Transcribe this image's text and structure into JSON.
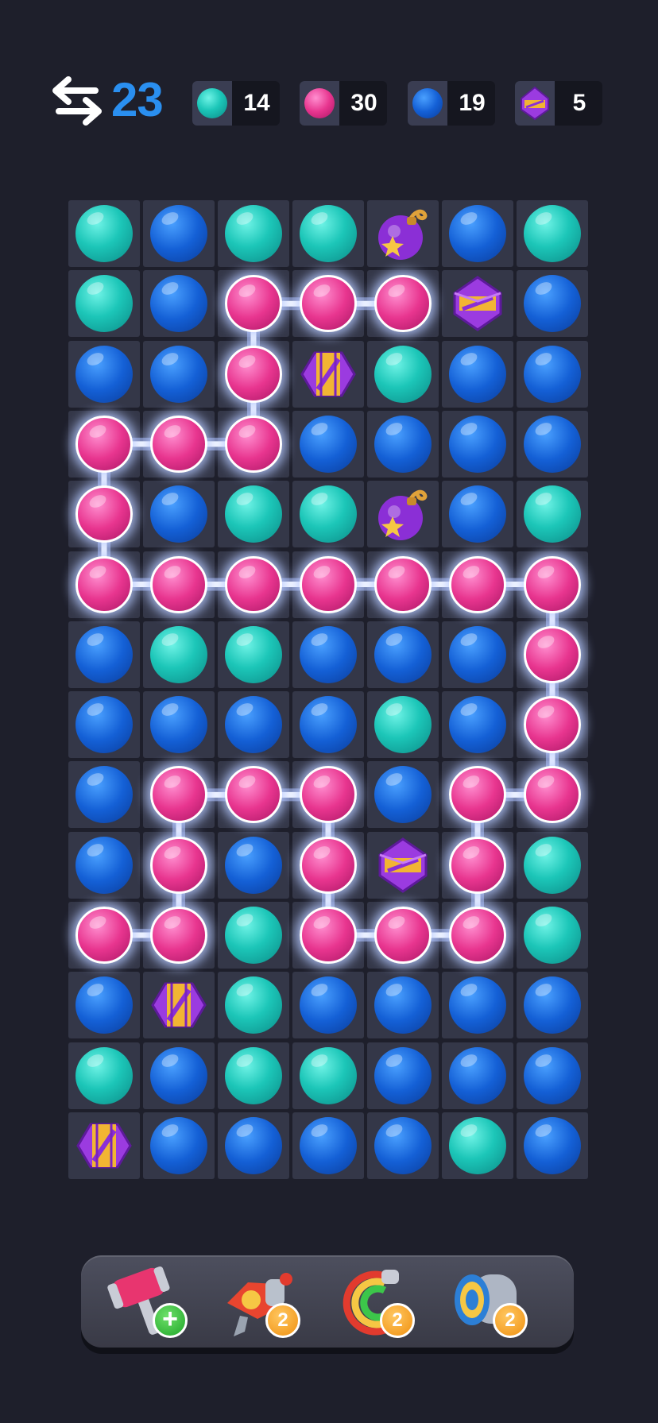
{
  "hud": {
    "moves_icon": "swap-arrows-icon",
    "moves_left": "23",
    "goals": [
      {
        "kind": "teal",
        "icon": "teal-ball-icon",
        "count": "14"
      },
      {
        "kind": "pink",
        "icon": "pink-ball-icon",
        "count": "30"
      },
      {
        "kind": "blue",
        "icon": "blue-ball-icon",
        "count": "19"
      },
      {
        "kind": "purple-lantern",
        "icon": "purple-lantern-icon",
        "count": "5"
      }
    ]
  },
  "colors": {
    "background": "#1e1f2b",
    "cell": "#343748",
    "moves_text": "#2a8ff0",
    "teal": "#1cc6b8",
    "pink": "#e8358f",
    "blue": "#1460d6",
    "purple": "#8b2fd6",
    "link_glow": "#ffffff"
  },
  "board": {
    "columns": 7,
    "rows": 14,
    "legend": {
      "T": "teal-ball",
      "B": "blue-ball",
      "P": "pink-ball",
      "O": "purple-bomb",
      "L": "purple-lantern",
      "C": "purple-candy"
    },
    "grid": [
      [
        "T",
        "B",
        "T",
        "T",
        "O",
        "B",
        "T"
      ],
      [
        "T",
        "B",
        "P",
        "P",
        "P",
        "L",
        "B"
      ],
      [
        "B",
        "B",
        "P",
        "C",
        "T",
        "B",
        "B"
      ],
      [
        "P",
        "P",
        "P",
        "B",
        "B",
        "B",
        "B"
      ],
      [
        "P",
        "B",
        "T",
        "T",
        "O",
        "B",
        "T"
      ],
      [
        "P",
        "P",
        "P",
        "P",
        "P",
        "P",
        "P"
      ],
      [
        "B",
        "T",
        "T",
        "B",
        "B",
        "B",
        "P"
      ],
      [
        "B",
        "B",
        "B",
        "B",
        "T",
        "B",
        "P"
      ],
      [
        "B",
        "P",
        "P",
        "P",
        "B",
        "P",
        "P"
      ],
      [
        "B",
        "P",
        "B",
        "P",
        "L",
        "P",
        "T"
      ],
      [
        "P",
        "P",
        "T",
        "P",
        "P",
        "P",
        "T"
      ],
      [
        "B",
        "C",
        "T",
        "B",
        "B",
        "B",
        "B"
      ],
      [
        "T",
        "B",
        "T",
        "T",
        "B",
        "B",
        "B"
      ],
      [
        "C",
        "B",
        "B",
        "B",
        "B",
        "T",
        "B"
      ]
    ],
    "selected_path": [
      [
        1,
        4
      ],
      [
        1,
        3
      ],
      [
        1,
        2
      ],
      [
        2,
        2
      ],
      [
        3,
        2
      ],
      [
        3,
        1
      ],
      [
        3,
        0
      ],
      [
        4,
        0
      ],
      [
        5,
        0
      ],
      [
        5,
        1
      ],
      [
        5,
        2
      ],
      [
        5,
        3
      ],
      [
        5,
        4
      ],
      [
        5,
        5
      ],
      [
        5,
        6
      ],
      [
        6,
        6
      ],
      [
        7,
        6
      ],
      [
        8,
        6
      ],
      [
        8,
        5
      ],
      [
        9,
        5
      ],
      [
        10,
        5
      ],
      [
        10,
        4
      ],
      [
        10,
        3
      ],
      [
        9,
        3
      ],
      [
        8,
        3
      ],
      [
        8,
        2
      ],
      [
        8,
        1
      ],
      [
        9,
        1
      ],
      [
        10,
        1
      ],
      [
        10,
        0
      ]
    ]
  },
  "boosters": [
    {
      "name": "hammer",
      "icon": "hammer-icon",
      "badge": "+"
    },
    {
      "name": "rocket",
      "icon": "rocket-icon",
      "badge": "2"
    },
    {
      "name": "magnet",
      "icon": "rainbow-magnet-icon",
      "badge": "2"
    },
    {
      "name": "cannon",
      "icon": "cannon-icon",
      "badge": "2"
    }
  ]
}
